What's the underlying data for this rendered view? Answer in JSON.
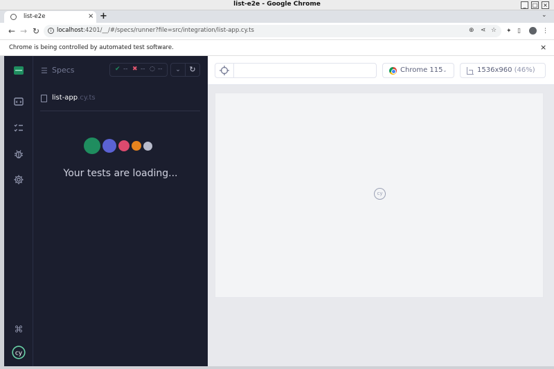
{
  "window": {
    "title": "list-e2e - Google Chrome",
    "minimize_glyph": "_",
    "maximize_glyph": "□",
    "close_glyph": "×"
  },
  "tab": {
    "title": "list-e2e",
    "close_glyph": "×"
  },
  "new_tab_glyph": "+",
  "tab_menu_glyph": "⌄",
  "toolbar": {
    "back_glyph": "←",
    "forward_glyph": "→",
    "reload_glyph": "↻",
    "url_host": "localhost",
    "url_rest": ":4201/__/#/specs/runner?file=src/integration/list-app.cy.ts"
  },
  "infobar": {
    "message": "Chrome is being controlled by automated test software.",
    "close_glyph": "×"
  },
  "specs_panel": {
    "title": "Specs",
    "stats": {
      "passed": "--",
      "failed": "--",
      "pending": "--"
    },
    "spec_name": "list-app",
    "spec_ext": ".cy.ts",
    "loading_text": "Your tests are loading...",
    "loading_dot_colors": [
      "#1f8d5f",
      "#5b62d4",
      "#dc4a6e",
      "#e5841e",
      "#b9bccb"
    ]
  },
  "runner": {
    "url_placeholder": "",
    "browser_label": "Chrome 115",
    "viewport_size": "1536x960",
    "viewport_percent": "(46%)",
    "spinner_text": "cy"
  },
  "colors": {
    "nav_bg": "#1b1e2e",
    "runner_bg": "#e8e9ed",
    "accent_green": "#1f8d5f"
  }
}
